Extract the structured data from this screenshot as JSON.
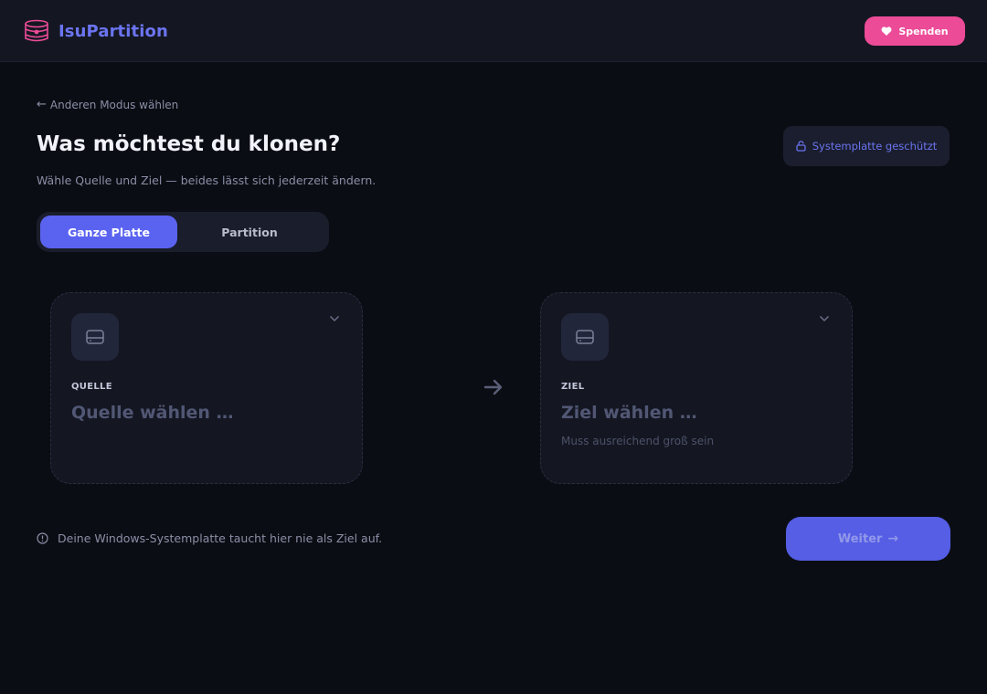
{
  "app": {
    "name": "IsuPartition",
    "donate_label": "Spenden"
  },
  "nav": {
    "back_label": "Anderen Modus wählen"
  },
  "header": {
    "title": "Was möchtest du klonen?",
    "subtitle": "Wähle Quelle und Ziel — beides lässt sich jederzeit ändern.",
    "system_badge": "Systemplatte geschützt"
  },
  "mode_toggle": {
    "options": [
      "Ganze Platte",
      "Partition"
    ],
    "selected": "Ganze Platte"
  },
  "source_card": {
    "caption": "QUELLE",
    "placeholder": "Quelle wählen …"
  },
  "target_card": {
    "caption": "ZIEL",
    "placeholder": "Ziel wählen …",
    "hint": "Muss ausreichend groß sein"
  },
  "footer": {
    "note": "Deine Windows-Systemplatte taucht hier nie als Ziel auf.",
    "next_label": "Weiter"
  },
  "colors": {
    "accent": "#5a63f0",
    "donate": "#ec4b98",
    "background": "#0b0d14",
    "card": "#141722"
  },
  "icons": {
    "logo": "disk-stack-logo-icon",
    "donate": "heart-hand-icon",
    "back": "arrow-left-icon",
    "lock": "lock-icon",
    "disk": "hard-drive-icon",
    "chevron": "chevron-down-icon",
    "between": "arrow-right-icon",
    "info": "info-circle-icon"
  }
}
